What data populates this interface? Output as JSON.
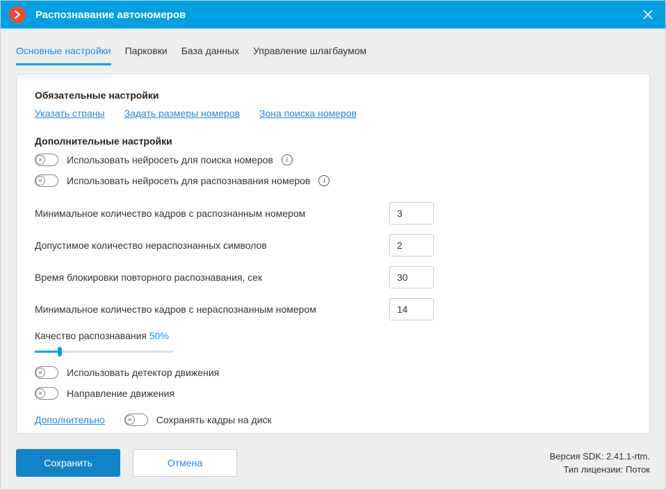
{
  "titlebar": {
    "title": "Распознавание автономеров"
  },
  "tabs": [
    {
      "label": "Основные настройки",
      "active": true
    },
    {
      "label": "Парковки",
      "active": false
    },
    {
      "label": "База данных",
      "active": false
    },
    {
      "label": "Управление шлагбаумом",
      "active": false
    }
  ],
  "sections": {
    "required": {
      "title": "Обязательные настройки",
      "links": [
        "Указать страны",
        "Задать размеры номеров",
        "Зона поиска номеров"
      ]
    },
    "additional": {
      "title": "Дополнительные настройки",
      "toggles": {
        "nn_search": "Использовать нейросеть для поиска номеров",
        "nn_recognize": "Использовать нейросеть для распознавания номеров",
        "motion_detector": "Использовать детектор движения",
        "direction": "Направление движения",
        "save_frames": "Сохранять кадры на диск"
      },
      "fields": {
        "min_recognized": {
          "label": "Минимальное количество кадров с распознанным номером",
          "value": "3"
        },
        "allowed_unrecognized": {
          "label": "Допустимое количество нераспознанных символов",
          "value": "2"
        },
        "block_time": {
          "label": "Время блокировки повторного распознавания, сек",
          "value": "30"
        },
        "min_unrecognized": {
          "label": "Минимальное количество кадров с нераспознанным номером",
          "value": "14"
        }
      },
      "quality": {
        "label": "Качество распознавания ",
        "value": "50%",
        "percent": 18
      },
      "more_link": "Дополнительно"
    }
  },
  "footer": {
    "save": "Сохранить",
    "cancel": "Отмена",
    "sdk_label": "Версия SDK:  ",
    "sdk_version": "2.41.1-rtm.",
    "license_label": "Тип лицензии: ",
    "license_value": "Поток"
  }
}
